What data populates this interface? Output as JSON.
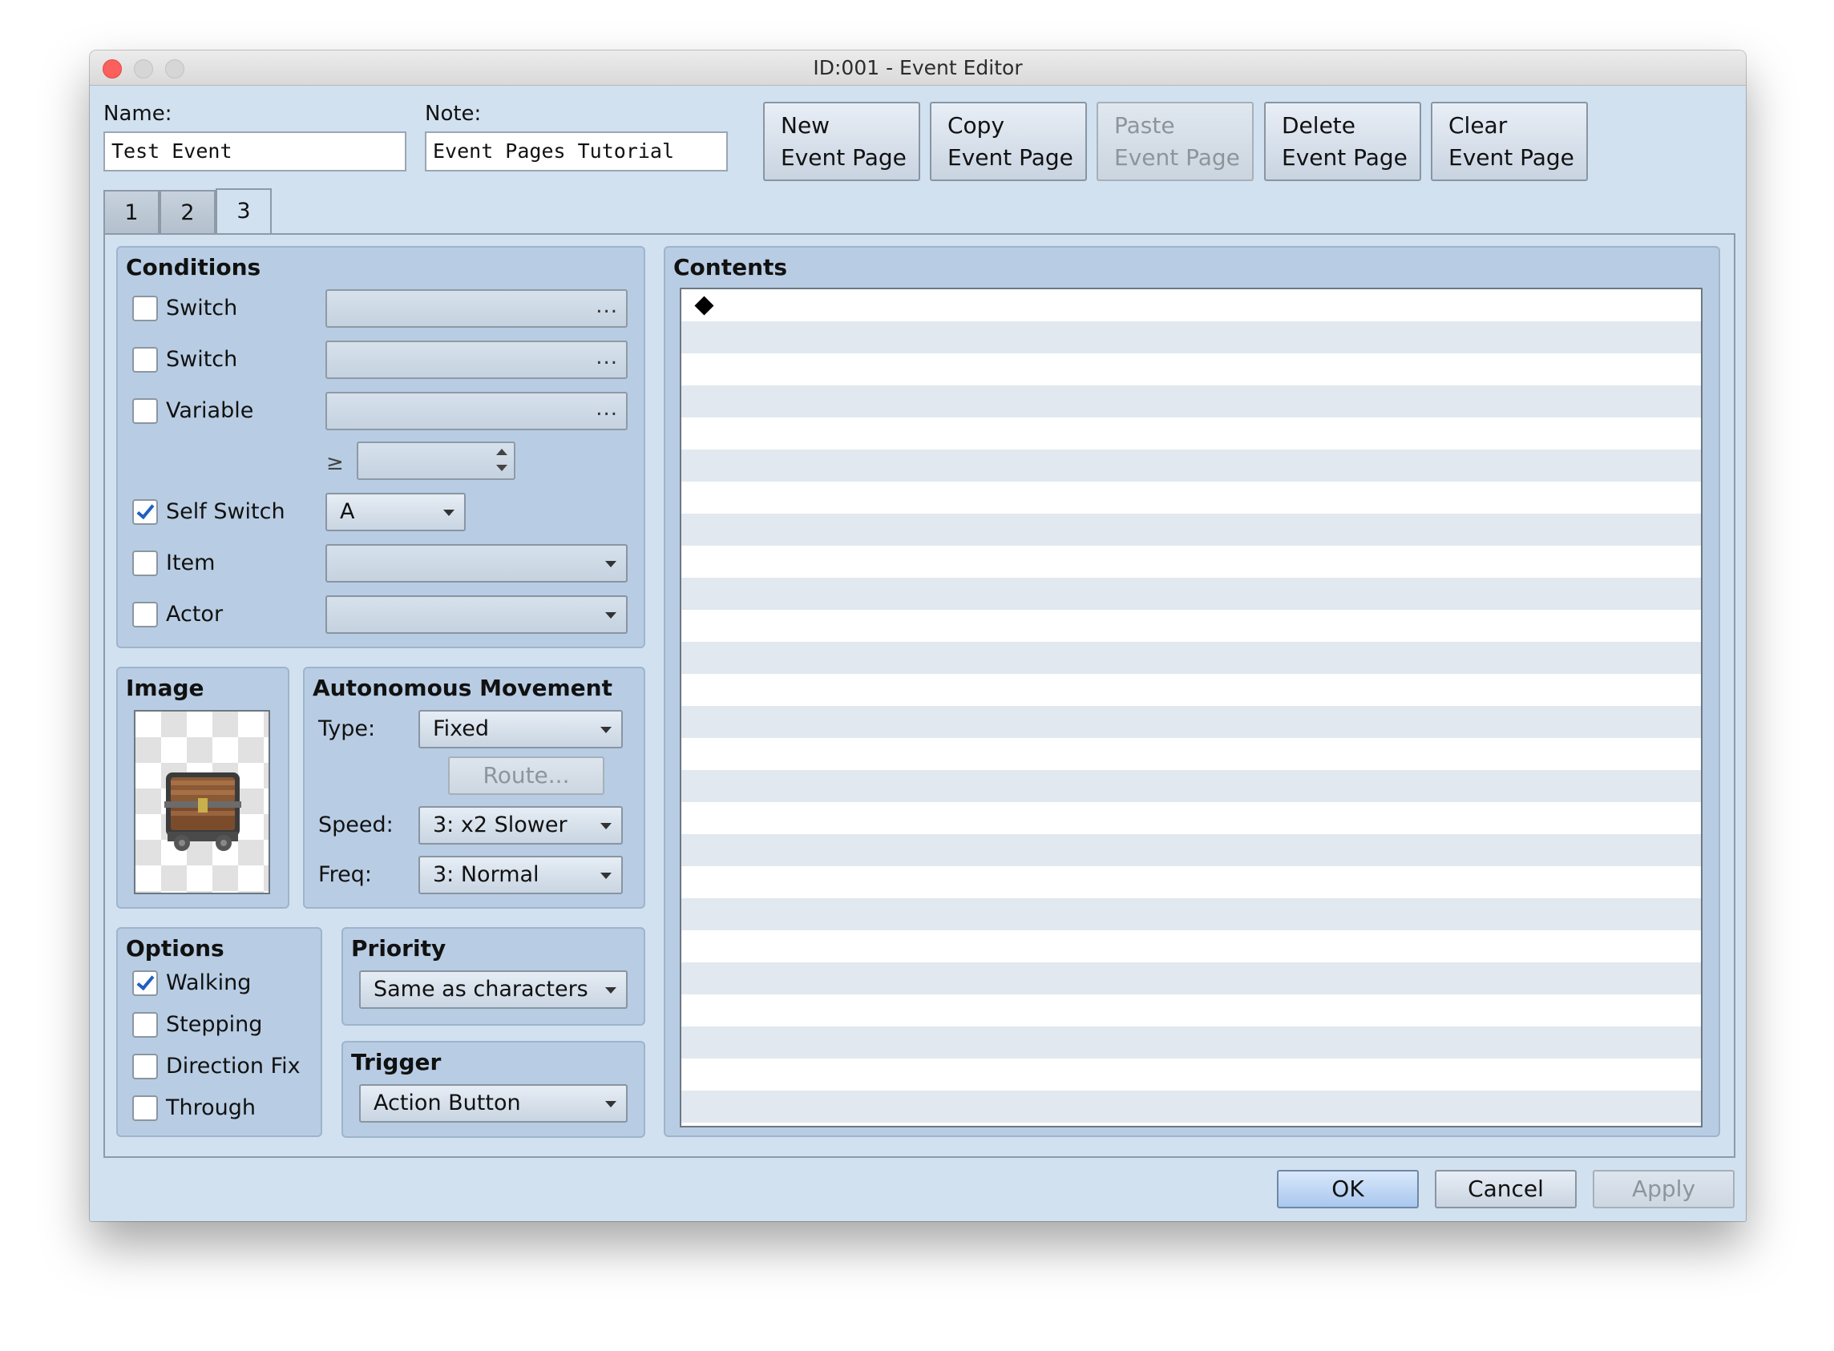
{
  "window": {
    "title": "ID:001 - Event Editor"
  },
  "name": {
    "label": "Name:",
    "value": "Test Event"
  },
  "note": {
    "label": "Note:",
    "value": "Event Pages Tutorial"
  },
  "toolbar": {
    "new": "New\nEvent Page",
    "copy": "Copy\nEvent Page",
    "paste": "Paste\nEvent Page",
    "delete": "Delete\nEvent Page",
    "clear": "Clear\nEvent Page"
  },
  "tabs": [
    "1",
    "2",
    "3"
  ],
  "active_tab": "3",
  "conditions": {
    "title": "Conditions",
    "switch1": {
      "label": "Switch",
      "checked": false,
      "value": "",
      "button": "..."
    },
    "switch2": {
      "label": "Switch",
      "checked": false,
      "value": "",
      "button": "..."
    },
    "variable": {
      "label": "Variable",
      "checked": false,
      "value": "",
      "button": "...",
      "compare": "≥",
      "number": ""
    },
    "self_switch": {
      "label": "Self Switch",
      "checked": true,
      "value": "A"
    },
    "item": {
      "label": "Item",
      "checked": false,
      "value": ""
    },
    "actor": {
      "label": "Actor",
      "checked": false,
      "value": ""
    }
  },
  "image": {
    "title": "Image",
    "icon": "treasure-chest-icon"
  },
  "movement": {
    "title": "Autonomous Movement",
    "type_label": "Type:",
    "type_value": "Fixed",
    "route": "Route...",
    "speed_label": "Speed:",
    "speed_value": "3: x2 Slower",
    "freq_label": "Freq:",
    "freq_value": "3: Normal"
  },
  "options": {
    "title": "Options",
    "walking": {
      "label": "Walking",
      "checked": true
    },
    "stepping": {
      "label": "Stepping",
      "checked": false
    },
    "direction_fix": {
      "label": "Direction Fix",
      "checked": false
    },
    "through": {
      "label": "Through",
      "checked": false
    }
  },
  "priority": {
    "title": "Priority",
    "value": "Same as characters"
  },
  "trigger": {
    "title": "Trigger",
    "value": "Action Button"
  },
  "contents": {
    "title": "Contents",
    "first_line_icon": "diamond-icon"
  },
  "footer": {
    "ok": "OK",
    "cancel": "Cancel",
    "apply": "Apply"
  }
}
